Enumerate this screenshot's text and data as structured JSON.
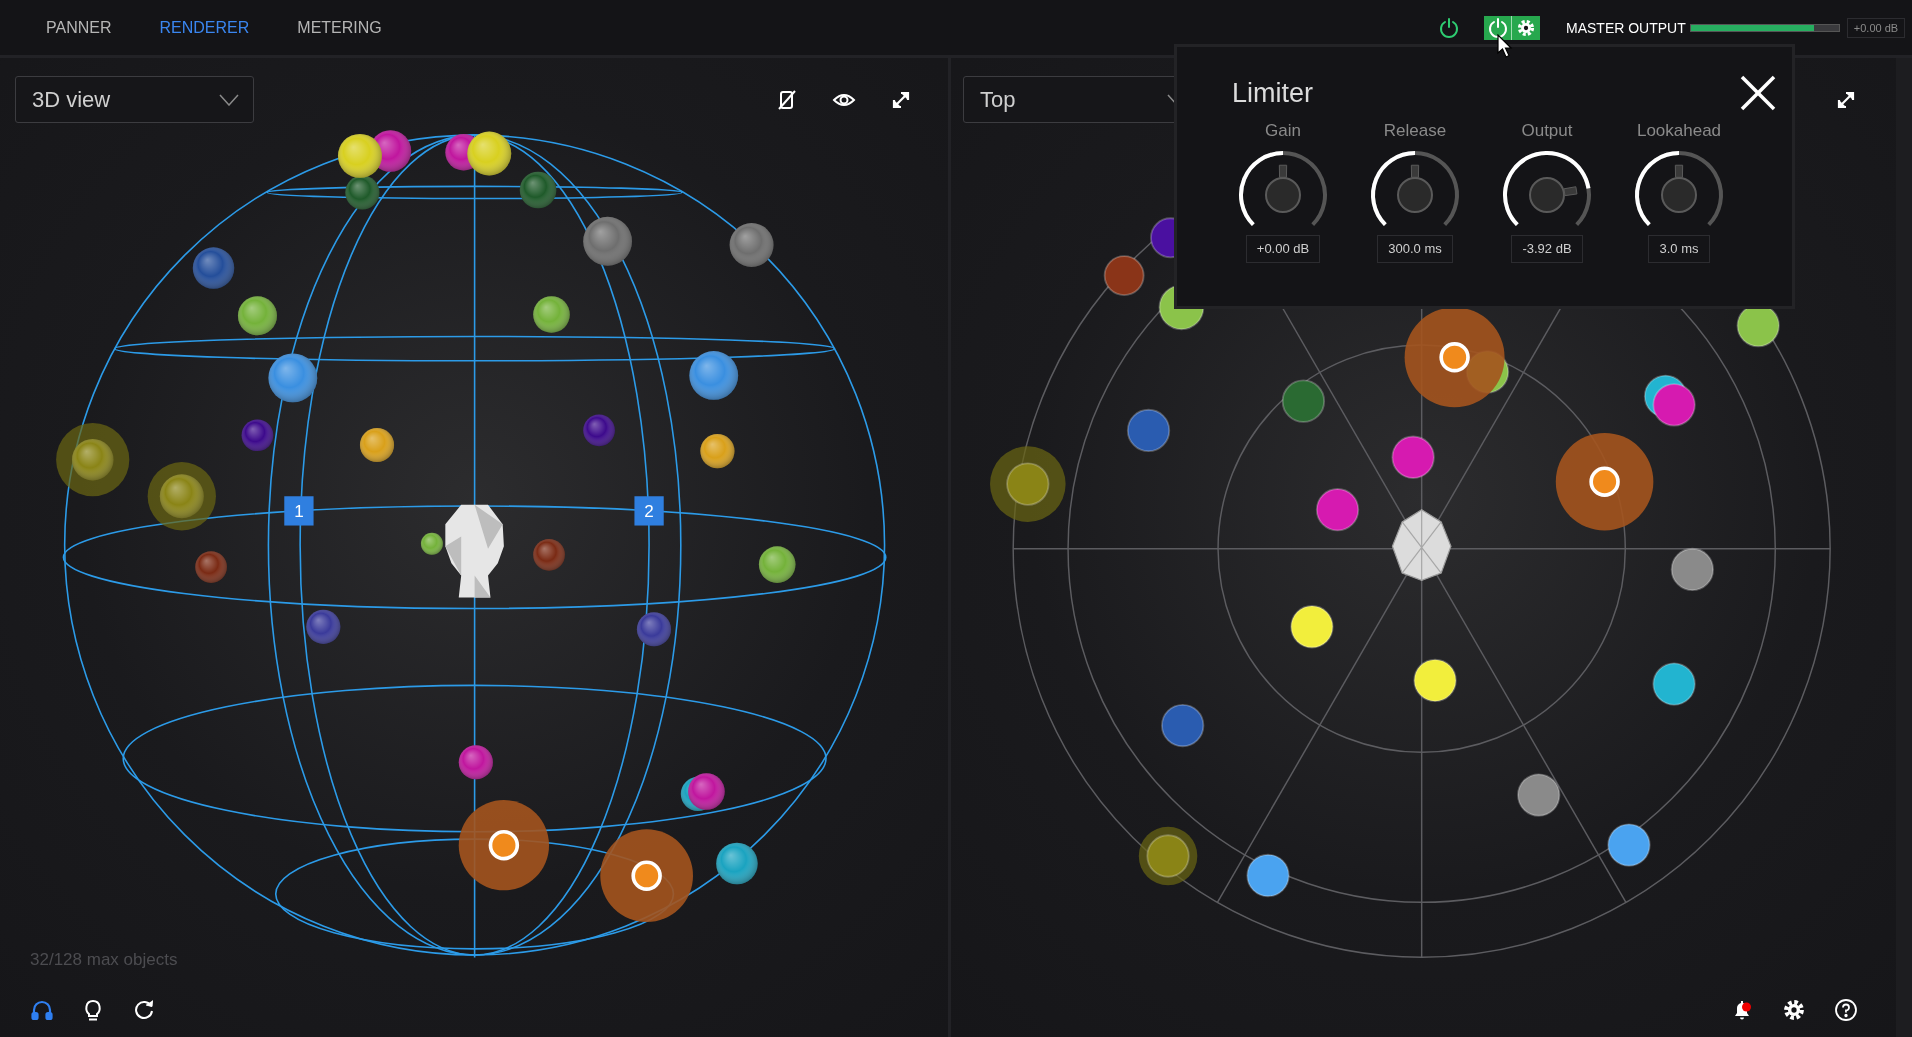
{
  "tabs": [
    {
      "label": "PANNER",
      "selected": false
    },
    {
      "label": "RENDERER",
      "selected": true
    },
    {
      "label": "METERING",
      "selected": false
    }
  ],
  "renderer_power": {
    "on": true
  },
  "master_output": {
    "label": "MASTER OUTPUT",
    "level": 0.83,
    "reading": "+0.00 dB"
  },
  "views": [
    {
      "kind": "sphere",
      "view": "3D view",
      "speakers": [
        "1",
        "2"
      ],
      "object_count": "32/128 max objects",
      "tools": [
        {
          "kind": "headphones",
          "on": true
        },
        {
          "kind": "bulb",
          "on": false
        },
        {
          "kind": "reset",
          "on": false
        }
      ]
    },
    {
      "kind": "top",
      "view": "Top",
      "tools": [
        {
          "kind": "bell",
          "alert": true
        },
        {
          "kind": "settings"
        },
        {
          "kind": "help"
        }
      ]
    }
  ],
  "limiter": {
    "on": true,
    "title": "Limiter",
    "knobs": [
      {
        "label": "Gain",
        "level": 0.5,
        "reading": "+0.00 dB"
      },
      {
        "label": "Release",
        "level": 0.5,
        "reading": "300.0 ms"
      },
      {
        "label": "Output",
        "level": 0.8,
        "reading": "-3.92 dB"
      },
      {
        "label": "Lookahead",
        "level": 0.5,
        "reading": "3.0 ms"
      }
    ]
  }
}
